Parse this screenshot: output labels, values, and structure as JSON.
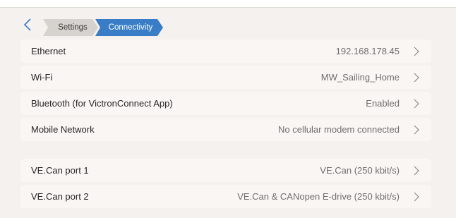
{
  "breadcrumb": {
    "items": [
      {
        "label": "Settings"
      },
      {
        "label": "Connectivity"
      }
    ]
  },
  "colors": {
    "accent": "#387dc5",
    "crumb_inactive": "#d6d3cf",
    "background": "#f4f1ee",
    "row_background": "#faf6f4"
  },
  "icons": {
    "back": "chevron-left-icon",
    "row_arrow": "chevron-right-icon"
  },
  "network": [
    {
      "label": "Ethernet",
      "value": "192.168.178.45"
    },
    {
      "label": "Wi-Fi",
      "value": "MW_Sailing_Home"
    },
    {
      "label": "Bluetooth (for VictronConnect App)",
      "value": "Enabled"
    },
    {
      "label": "Mobile Network",
      "value": "No cellular modem connected"
    }
  ],
  "can_ports": [
    {
      "label": "VE.Can port 1",
      "value": "VE.Can (250 kbit/s)"
    },
    {
      "label": "VE.Can port 2",
      "value": "VE.Can & CANopen E-drive (250 kbit/s)"
    }
  ]
}
